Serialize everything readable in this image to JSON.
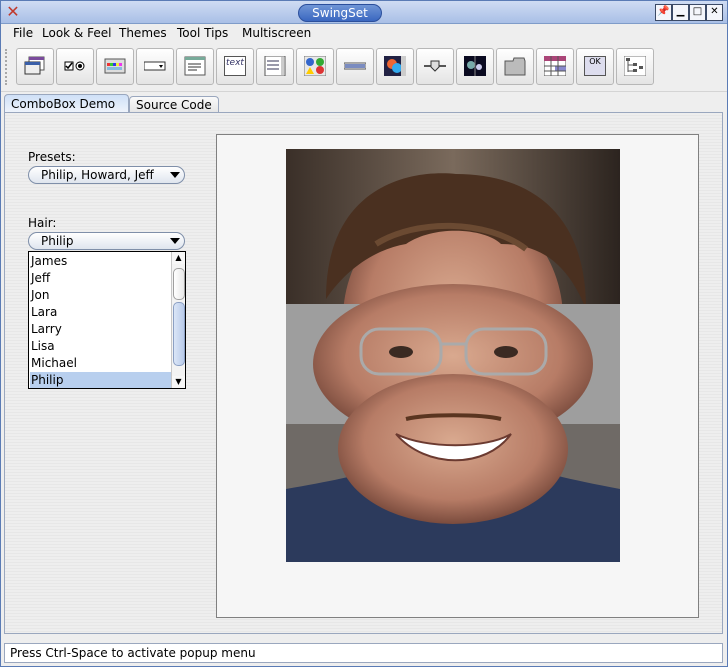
{
  "window": {
    "title": "SwingSet"
  },
  "menubar": {
    "items": [
      "File",
      "Look & Feel",
      "Themes",
      "Tool Tips",
      "Multiscreen"
    ]
  },
  "toolbar": {
    "buttons": [
      "internal-frame-icon",
      "checkbox-radio-icon",
      "color-chooser-icon",
      "combobox-icon",
      "file-chooser-icon",
      "editor-pane-icon",
      "list-icon",
      "option-pane-icon",
      "progress-bar-icon",
      "scroll-pane-icon",
      "slider-icon",
      "split-pane-icon",
      "tabbed-pane-icon",
      "table-icon",
      "tooltip-icon",
      "tree-icon"
    ],
    "text_icon_label": "text",
    "tooltip_icon_label": "OK"
  },
  "tabs": {
    "demo": "ComboBox Demo",
    "source": "Source Code"
  },
  "presets": {
    "label": "Presets:",
    "value": "Philip, Howard, Jeff"
  },
  "hair": {
    "label": "Hair:",
    "value": "Philip",
    "options": [
      "James",
      "Jeff",
      "Jon",
      "Lara",
      "Larry",
      "Lisa",
      "Michael",
      "Philip"
    ],
    "selected": "Philip"
  },
  "status": {
    "text": "Press Ctrl-Space to activate popup menu"
  },
  "colors": {
    "selection": "#b8cfee",
    "title_pill": "#3a67c0"
  }
}
